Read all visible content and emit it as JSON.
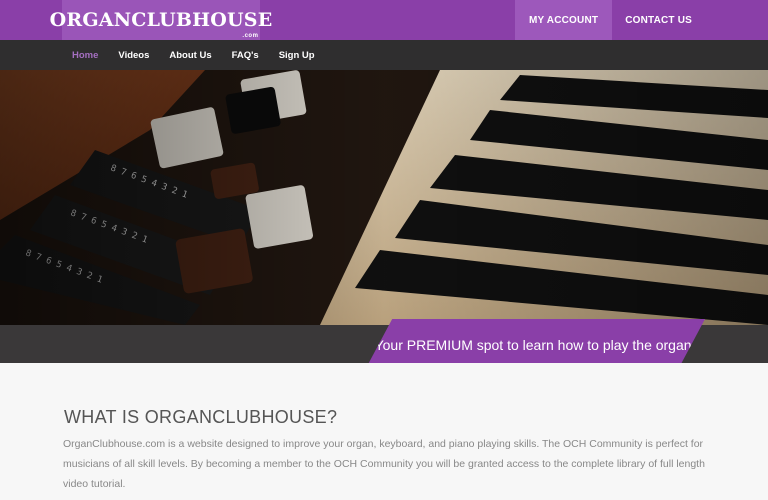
{
  "header": {
    "logo_text": "ORGANCLUBHOUSE",
    "logo_suffix": ".com",
    "top_links": [
      "MY ACCOUNT",
      "CONTACT US"
    ]
  },
  "nav": {
    "items": [
      "Home",
      "Videos",
      "About Us",
      "FAQ's",
      "Sign Up"
    ],
    "active": "Home"
  },
  "hero": {
    "image": "organ-keys-photo",
    "tagline": "Your PREMIUM spot to learn how to play the organ."
  },
  "content": {
    "heading": "WHAT IS ORGANCLUBHOUSE?",
    "paragraph": "OrganClubhouse.com is a website designed to improve your organ, keyboard, and piano playing skills. The OCH Community is perfect for musicians of all skill levels. By becoming a member to the OCH Community you will be granted access to the complete library of full length video tutorial."
  },
  "colors": {
    "brand_purple": "#8a3fa8",
    "nav_dark": "#2f2e2f",
    "active_nav": "#a46fc0"
  }
}
